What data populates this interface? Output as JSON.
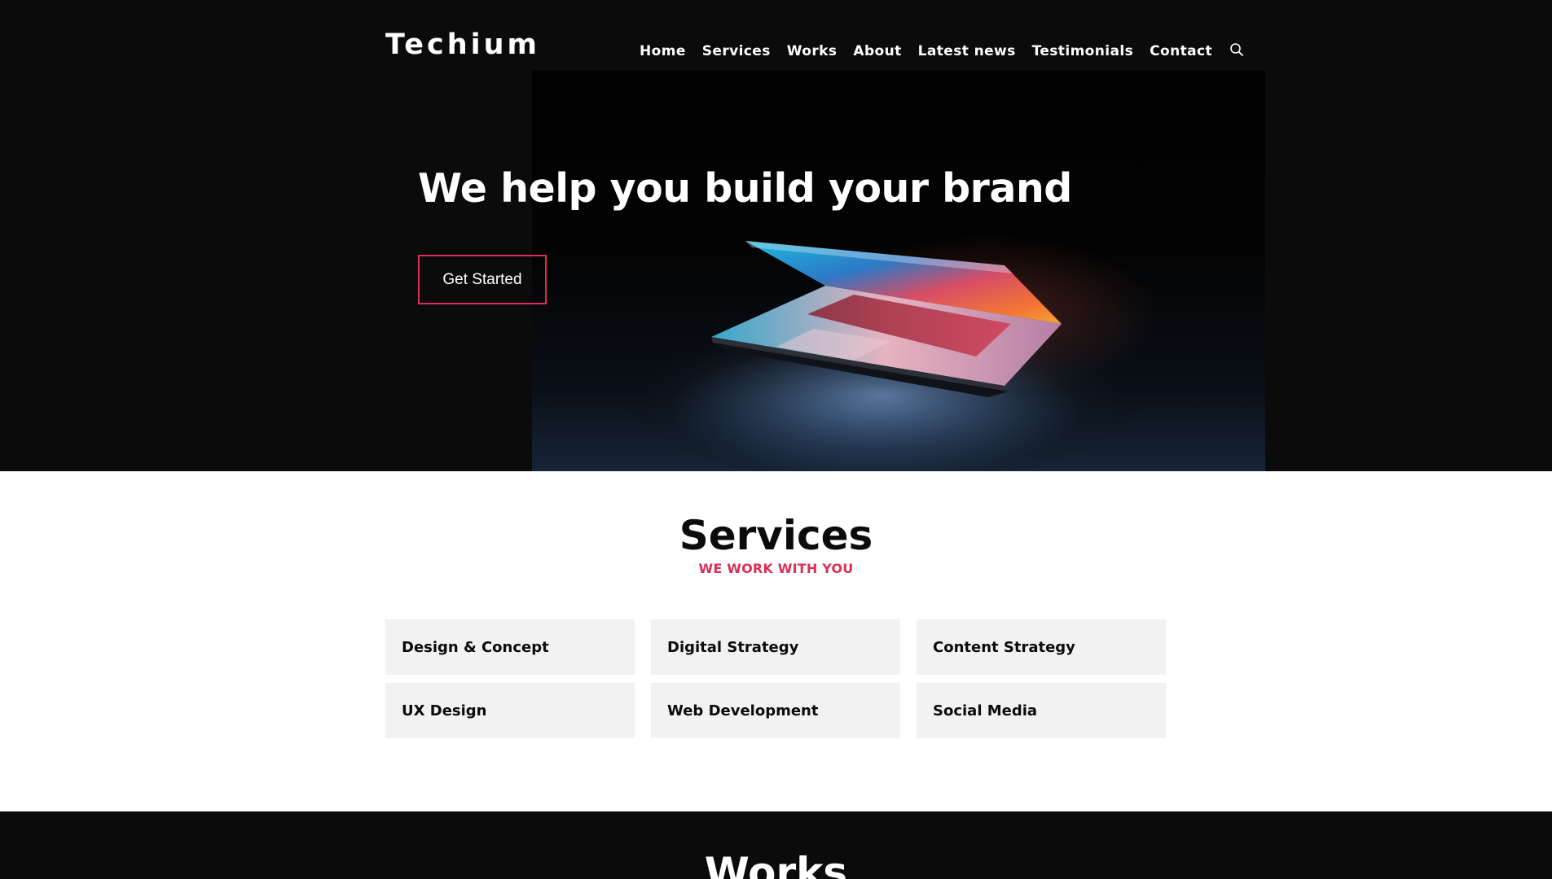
{
  "header": {
    "logo": "Techium",
    "nav": [
      {
        "label": "Home"
      },
      {
        "label": "Services"
      },
      {
        "label": "Works"
      },
      {
        "label": "About"
      },
      {
        "label": "Latest news"
      },
      {
        "label": "Testimonials"
      },
      {
        "label": "Contact"
      }
    ],
    "search_icon": "search-icon"
  },
  "hero": {
    "title": "We help you build your brand",
    "cta_label": "Get Started",
    "image": "laptop-dark-glow"
  },
  "services": {
    "title": "Services",
    "subtitle": "WE WORK WITH YOU",
    "items": [
      {
        "label": "Design & Concept"
      },
      {
        "label": "Digital Strategy"
      },
      {
        "label": "Content Strategy"
      },
      {
        "label": "UX Design"
      },
      {
        "label": "Web Development"
      },
      {
        "label": "Social Media"
      }
    ]
  },
  "works": {
    "title": "Works"
  },
  "colors": {
    "accent": "#dc2f55",
    "dark_bg": "#0b0b0b",
    "card_bg": "#f2f2f2",
    "text_light": "#ffffff",
    "text_dark": "#0b0b0b"
  }
}
